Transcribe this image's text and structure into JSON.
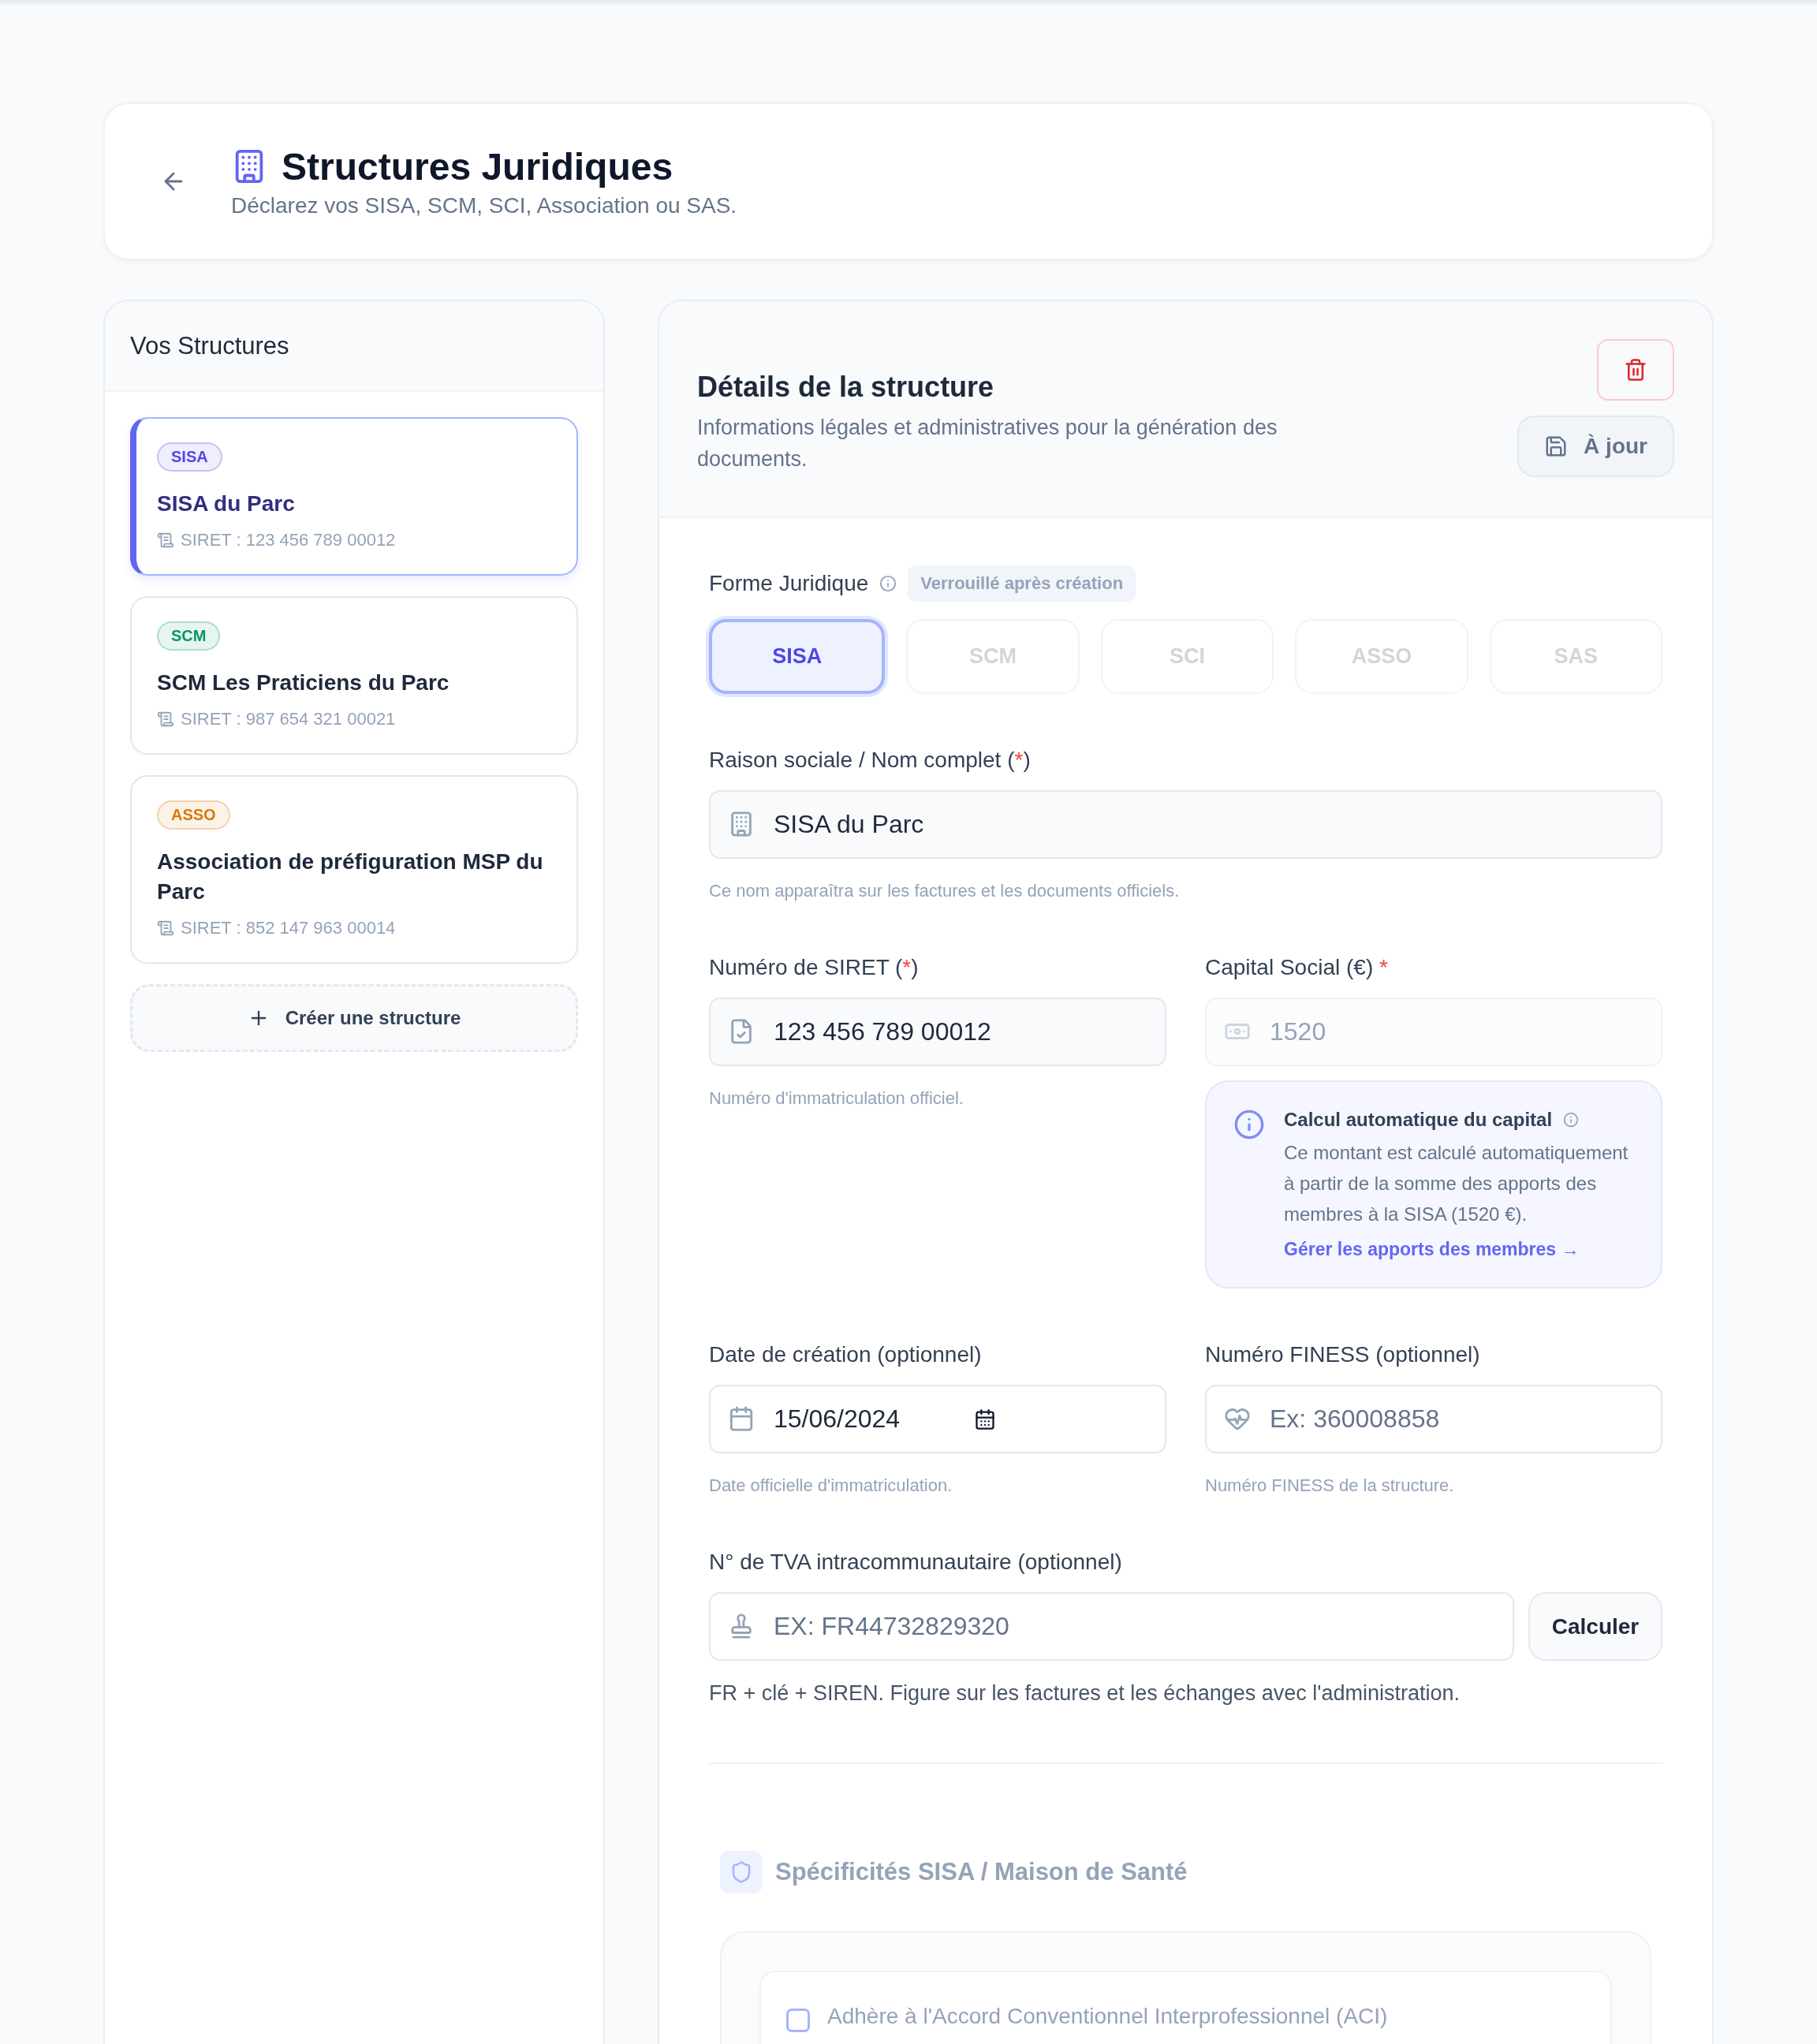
{
  "header": {
    "title": "Structures Juridiques",
    "subtitle": "Déclarez vos SISA, SCM, SCI, Association ou SAS."
  },
  "sidebar": {
    "title": "Vos Structures",
    "create_button": "Créer une structure",
    "items": [
      {
        "badge": "SISA",
        "color": "#4f46e5",
        "name": "SISA du Parc",
        "siret": "SIRET : 123 456 789 00012",
        "selected": true
      },
      {
        "badge": "SCM",
        "color": "#059669",
        "name": "SCM Les Praticiens du Parc",
        "siret": "SIRET : 987 654 321 00021",
        "selected": false
      },
      {
        "badge": "ASSO",
        "color": "#d97706",
        "name": "Association de préfiguration MSP du Parc",
        "siret": "SIRET : 852 147 963 00014",
        "selected": false
      }
    ]
  },
  "details": {
    "title": "Détails de la structure",
    "subtitle": "Informations légales et administratives pour la génération des documents.",
    "save_button": "À jour"
  },
  "legal_form": {
    "label": "Forme Juridique",
    "lock_badge": "Verrouillé après création",
    "options": [
      {
        "label": "SISA",
        "selected": true
      },
      {
        "label": "SCM",
        "selected": false
      },
      {
        "label": "SCI",
        "selected": false
      },
      {
        "label": "ASSO",
        "selected": false
      },
      {
        "label": "SAS",
        "selected": false
      }
    ]
  },
  "company_name": {
    "label": "Raison sociale / Nom complet (",
    "required_mark": "*",
    "label_end": ")",
    "value": "SISA du Parc",
    "hint": "Ce nom apparaîtra sur les factures et les documents officiels."
  },
  "siret": {
    "label": "Numéro de SIRET (",
    "required_mark": "*",
    "label_end": ")",
    "value": "123 456 789 00012",
    "hint": "Numéro d'immatriculation officiel."
  },
  "capital": {
    "label": "Capital Social (€) ",
    "required_mark": "*",
    "value": "1520",
    "disabled": true,
    "info": {
      "title": "Calcul automatique du capital",
      "text": "Ce montant est calculé automatiquement à partir de la somme des apports des membres à la SISA (1520 €).",
      "link": "Gérer les apports des membres →"
    }
  },
  "creation_date": {
    "label": "Date de création (optionnel)",
    "value": "15/06/2024",
    "hint": "Date officielle d'immatriculation."
  },
  "finess": {
    "label": "Numéro FINESS (optionnel)",
    "placeholder": "Ex: 360008858",
    "hint": "Numéro FINESS de la structure."
  },
  "vat": {
    "label": "N° de TVA intracommunautaire (optionnel)",
    "placeholder": "EX: FR44732829320",
    "button": "Calculer",
    "hint": "FR + clé + SIREN. Figure sur les factures et les échanges avec l'administration."
  },
  "sisa_section": {
    "title": "Spécificités SISA / Maison de Santé",
    "aci": {
      "label": "Adhère à l'Accord Conventionnel Interprofessionnel (ACI)",
      "checked": false
    }
  }
}
